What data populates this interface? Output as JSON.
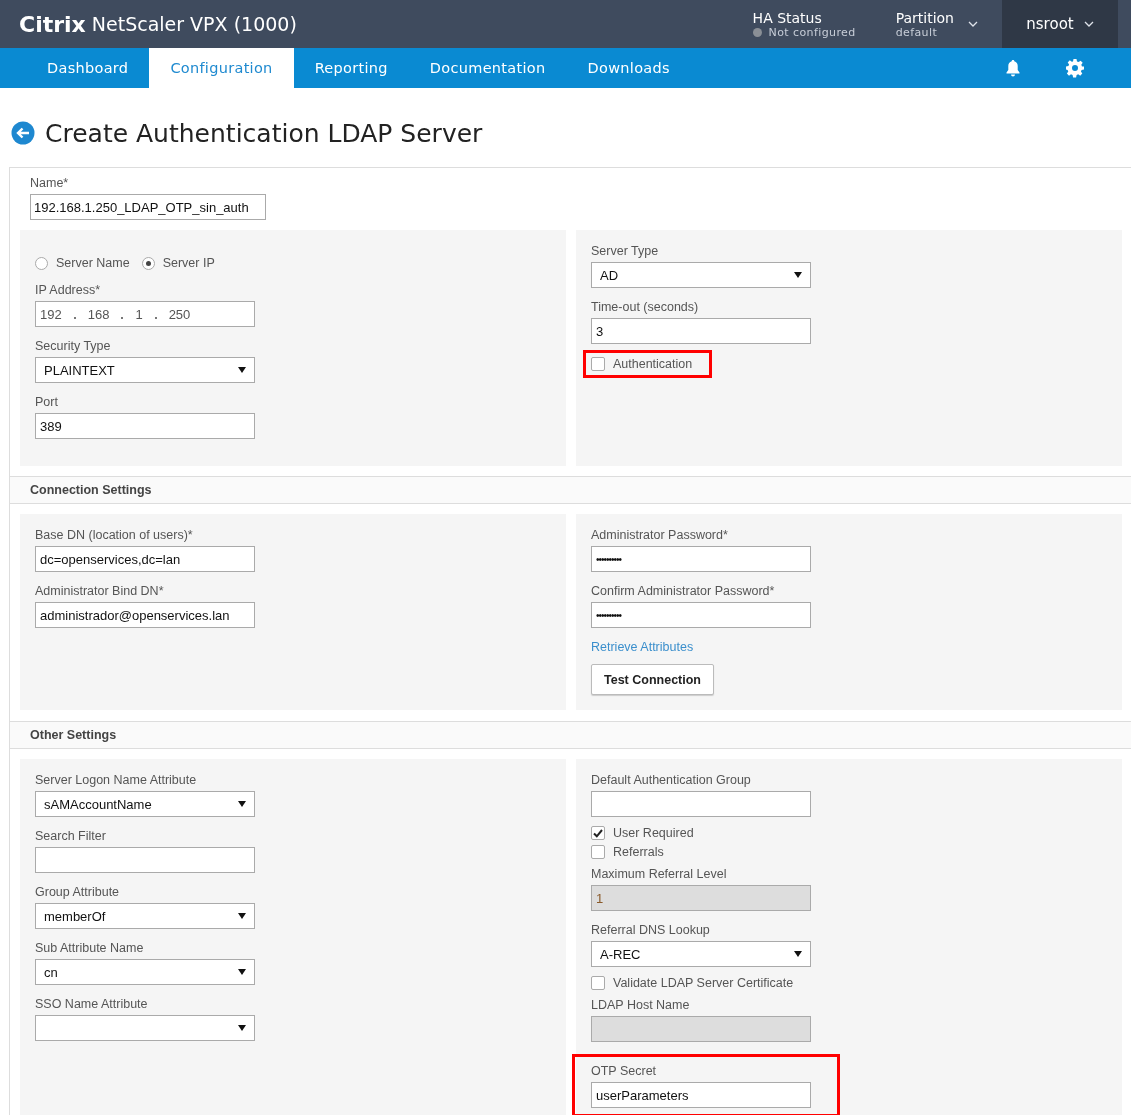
{
  "header": {
    "brand": "Citrix",
    "product": "NetScaler VPX (1000)",
    "ha_status": {
      "label": "HA Status",
      "value": "Not configured"
    },
    "partition": {
      "label": "Partition",
      "value": "default"
    },
    "user": "nsroot"
  },
  "nav": {
    "tabs": [
      {
        "label": "Dashboard",
        "selected": false
      },
      {
        "label": "Configuration",
        "selected": true
      },
      {
        "label": "Reporting",
        "selected": false
      },
      {
        "label": "Documentation",
        "selected": false
      },
      {
        "label": "Downloads",
        "selected": false
      }
    ]
  },
  "page_title": "Create Authentication LDAP Server",
  "name_field": {
    "label": "Name*",
    "value": "192.168.1.250_LDAP_OTP_sin_auth"
  },
  "sections": [
    {
      "panels": [
        {
          "fields": [
            {
              "kind": "radio",
              "options": [
                {
                  "label": "Server Name",
                  "selected": false
                },
                {
                  "label": "Server IP",
                  "selected": true
                }
              ]
            },
            {
              "kind": "ip",
              "label": "IP Address*",
              "octets": [
                "192",
                "168",
                "1",
                "250"
              ]
            },
            {
              "kind": "select",
              "label": "Security Type",
              "value": "PLAINTEXT"
            },
            {
              "kind": "text",
              "label": "Port",
              "value": "389",
              "disabled": false
            }
          ]
        },
        {
          "fields": [
            {
              "kind": "select",
              "label": "Server Type",
              "value": "AD"
            },
            {
              "kind": "text",
              "label": "Time-out (seconds)",
              "value": "3",
              "disabled": false
            },
            {
              "kind": "checkbox",
              "label": "Authentication",
              "checked": false,
              "highlighted": true
            }
          ]
        }
      ]
    },
    {
      "title": "Connection Settings",
      "panels": [
        {
          "fields": [
            {
              "kind": "text",
              "label": "Base DN (location of users)*",
              "value": "dc=openservices,dc=lan",
              "disabled": false
            },
            {
              "kind": "text",
              "label": "Administrator Bind DN*",
              "value": "administrador@openservices.lan",
              "disabled": false
            }
          ]
        },
        {
          "fields": [
            {
              "kind": "password",
              "label": "Administrator Password*",
              "value": "••••••••••"
            },
            {
              "kind": "password",
              "label": "Confirm Administrator Password*",
              "value": "••••••••••"
            },
            {
              "kind": "link",
              "label": "Retrieve Attributes"
            },
            {
              "kind": "button",
              "label": "Test Connection"
            }
          ]
        }
      ]
    },
    {
      "title": "Other Settings",
      "panels": [
        {
          "fields": [
            {
              "kind": "select",
              "label": "Server Logon Name Attribute",
              "value": "sAMAccountName"
            },
            {
              "kind": "text",
              "label": "Search Filter",
              "disabled": false
            },
            {
              "kind": "select",
              "label": "Group Attribute",
              "value": "memberOf"
            },
            {
              "kind": "select",
              "label": "Sub Attribute Name",
              "value": "cn"
            },
            {
              "kind": "select",
              "label": "SSO Name Attribute"
            }
          ]
        },
        {
          "fields": [
            {
              "kind": "text",
              "label": "Default Authentication Group",
              "disabled": false
            },
            {
              "kind": "checkbox",
              "label": "User Required",
              "checked": true,
              "highlighted": false
            },
            {
              "kind": "checkbox",
              "label": "Referrals",
              "checked": false,
              "highlighted": false
            },
            {
              "kind": "text",
              "label": "Maximum Referral Level",
              "value": "1",
              "disabled": true
            },
            {
              "kind": "select",
              "label": "Referral DNS Lookup",
              "value": "A-REC"
            },
            {
              "kind": "checkbox",
              "label": "Validate LDAP Server Certificate",
              "checked": false,
              "highlighted": false
            },
            {
              "kind": "text",
              "label": "LDAP Host Name",
              "disabled": true
            },
            {
              "kind": "text",
              "label": "OTP Secret",
              "value": "userParameters",
              "disabled": false,
              "highlighted": true
            }
          ]
        }
      ]
    }
  ]
}
